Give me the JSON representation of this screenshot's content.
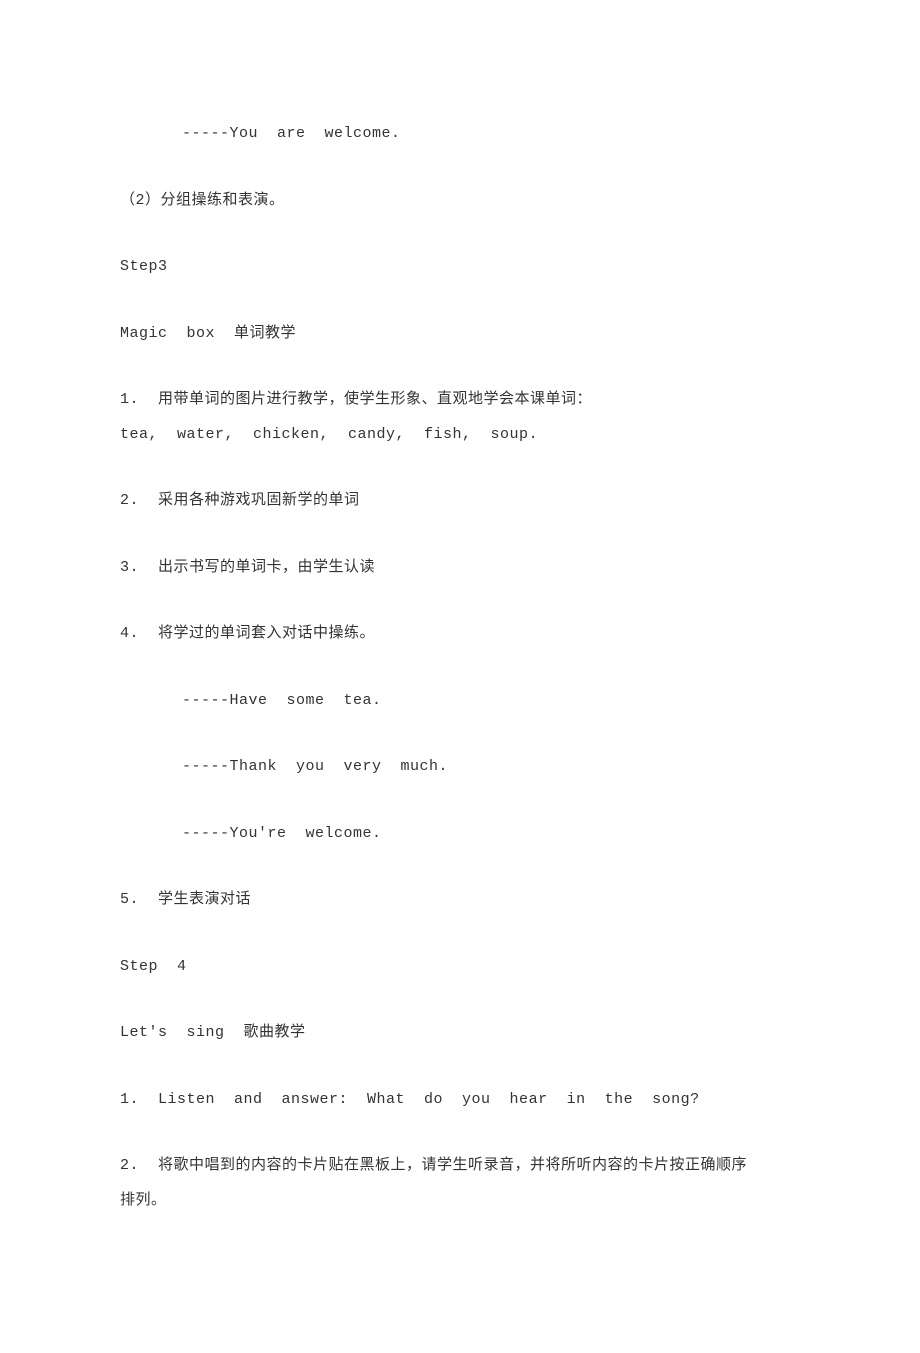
{
  "lines": {
    "l1": "-----You  are  welcome.",
    "l2": "（2）分组操练和表演。",
    "l3": "Step3",
    "l4": "Magic  box  单词教学",
    "l5": "1.  用带单词的图片进行教学，使学生形象、直观地学会本课单词：",
    "l6": "tea,  water,  chicken,  candy,  fish,  soup.",
    "l7": "2.  采用各种游戏巩固新学的单词",
    "l8": "3.  出示书写的单词卡，由学生认读",
    "l9": "4.  将学过的单词套入对话中操练。",
    "l10": "-----Have  some  tea.",
    "l11": "-----Thank  you  very  much.",
    "l12": "-----You're  welcome.",
    "l13": "5.  学生表演对话",
    "l14": "Step  4",
    "l15": "Let's  sing  歌曲教学",
    "l16": "1.  Listen  and  answer:  What  do  you  hear  in  the  song?",
    "l17": "2.  将歌中唱到的内容的卡片贴在黑板上，请学生听录音，并将所听内容的卡片按正确顺序",
    "l18": "排列。"
  }
}
